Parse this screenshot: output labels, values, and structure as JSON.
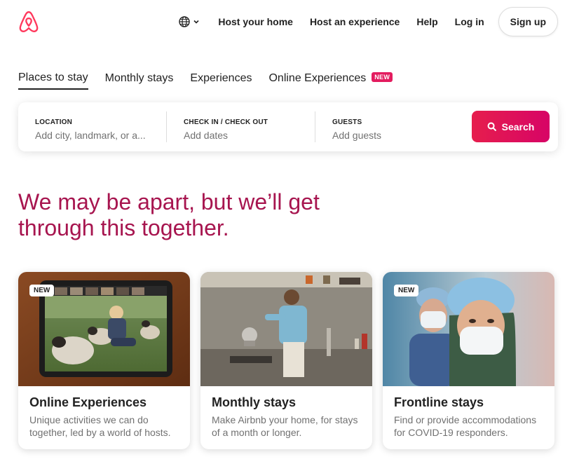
{
  "header": {
    "nav": [
      "Host your home",
      "Host an experience",
      "Help",
      "Log in"
    ],
    "signup": "Sign up"
  },
  "tabs": [
    {
      "label": "Places to stay",
      "active": true
    },
    {
      "label": "Monthly stays"
    },
    {
      "label": "Experiences"
    },
    {
      "label": "Online Experiences",
      "badge": "NEW"
    }
  ],
  "search": {
    "location_label": "LOCATION",
    "location_placeholder": "Add city, landmark, or a...",
    "dates_label": "CHECK IN / CHECK OUT",
    "dates_placeholder": "Add dates",
    "guests_label": "GUESTS",
    "guests_placeholder": "Add guests",
    "button": "Search"
  },
  "headline": "We may be apart, but we’ll get through this together.",
  "cards": [
    {
      "badge": "NEW",
      "title": "Online Experiences",
      "desc": "Unique activities we can do together, led by a world of hosts."
    },
    {
      "title": "Monthly stays",
      "desc": "Make Airbnb your home, for stays of a month or longer."
    },
    {
      "badge": "NEW",
      "title": "Frontline stays",
      "desc": "Find or provide accommodations for COVID-19 responders."
    }
  ],
  "colors": {
    "brand": "#ff385c",
    "headline": "#a7154f",
    "search": "#e61e4d"
  },
  "icons": [
    "airbnb-logo",
    "globe-icon",
    "chevron-down-icon",
    "search-icon"
  ]
}
